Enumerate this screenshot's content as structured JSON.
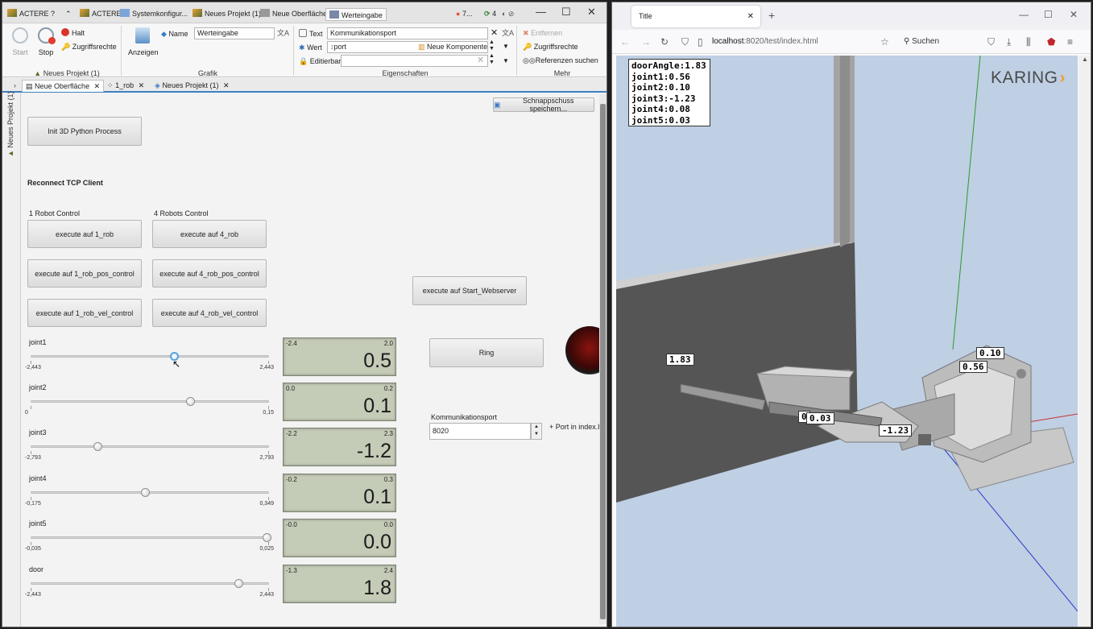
{
  "app": {
    "title_tabs": [
      "ACTERE ?",
      "ACTERE",
      "Systemkonfigur...",
      "Neues Projekt (1)",
      "Neue Oberfläche",
      "Werteingabe"
    ],
    "status_counts": [
      "7...",
      "4"
    ],
    "ribbon": {
      "start": "Start",
      "stop": "Stop",
      "halt": "Halt",
      "zugriffsrechte_left": "Zugriffsrechte",
      "group_project": "Neues Projekt (1)",
      "name_label": "Name",
      "name_value": "Werteingabe",
      "anzeigen": "Anzeigen",
      "group_grafik": "Grafik",
      "text_label": "Text",
      "text_value": "Kommunikationsport",
      "wert_label": "Wert",
      "wert_value": "port",
      "neue_komponente": "Neue Komponente",
      "editierbar_label": "Editierbar",
      "group_eigenschaften": "Eigenschaften",
      "entfernen": "Entfernen",
      "zugriffsrechte_right": "Zugriffsrechte",
      "referenzen": "Referenzen suchen",
      "group_mehr": "Mehr"
    },
    "doc_tabs": [
      "Neue Oberfläche",
      "1_rob",
      "Neues Projekt (1)"
    ],
    "sidebar_label": "Neues Projekt (1)",
    "snapshot_button": "Schnappschuss speichern...",
    "init_button": "Init 3D Python Process",
    "reconnect_label": "Reconnect TCP Client",
    "robot1_label": "1 Robot Control",
    "robot4_label": "4 Robots Control",
    "buttons_col1": [
      "execute auf 1_rob",
      "execute auf 1_rob_pos_control",
      "execute auf 1_rob_vel_control"
    ],
    "buttons_col2": [
      "execute auf 4_rob",
      "execute auf 4_rob_pos_control",
      "execute auf 4_rob_vel_control"
    ],
    "webserver_button": "execute auf Start_Webserver",
    "ring_button": "Ring",
    "port_label": "Kommunikationsport",
    "port_value": "8020",
    "port_note": "+ Port in index.ht",
    "sliders": [
      {
        "name": "joint1",
        "min": "-2,443",
        "max": "2,443",
        "fraction": 0.6
      },
      {
        "name": "joint2",
        "min": "0",
        "max": "0,15",
        "fraction": 0.67
      },
      {
        "name": "joint3",
        "min": "-2,793",
        "max": "2,793",
        "fraction": 0.28
      },
      {
        "name": "joint4",
        "min": "-0,175",
        "max": "0,349",
        "fraction": 0.48
      },
      {
        "name": "joint5",
        "min": "-0,035",
        "max": "0,025",
        "fraction": 0.99
      },
      {
        "name": "door",
        "min": "-2,443",
        "max": "2,443",
        "fraction": 0.87
      }
    ],
    "displays": [
      {
        "min": "-2.4",
        "max": "2.0",
        "value": "0.5"
      },
      {
        "min": "0.0",
        "max": "0.2",
        "value": "0.1"
      },
      {
        "min": "-2.2",
        "max": "2.3",
        "value": "-1.2"
      },
      {
        "min": "-0.2",
        "max": "0.3",
        "value": "0.1"
      },
      {
        "min": "-0.0",
        "max": "0.0",
        "value": "0.0"
      },
      {
        "min": "-1.3",
        "max": "2.4",
        "value": "1.8"
      }
    ]
  },
  "browser": {
    "tab_title": "Title",
    "url_host": "localhost",
    "url_rest": ":8020/test/index.html",
    "search_placeholder": "Suchen",
    "logo": "KARING",
    "debug_lines": [
      "doorAngle:1.83",
      "joint1:0.56",
      "joint2:0.10",
      "joint3:-1.23",
      "joint4:0.08",
      "joint5:0.03"
    ],
    "labels": {
      "door": "1.83",
      "j1": "0.56",
      "j2": "0.10",
      "j3": "-1.23",
      "j4": "0",
      "j5": "0.03"
    }
  }
}
